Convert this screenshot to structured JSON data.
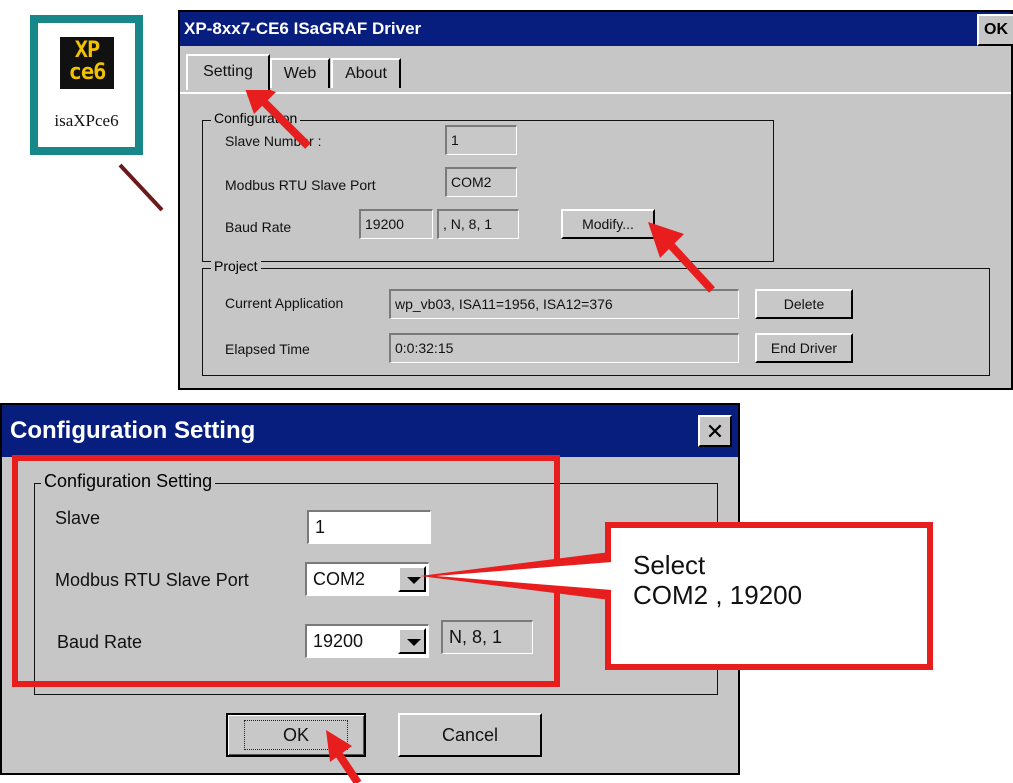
{
  "desktop_icon": {
    "image_text_line1": "XP",
    "image_text_line2": "ce6",
    "label": "isaXPce6",
    "icon": "isaXPce6-app-icon"
  },
  "driver_window": {
    "title": "XP-8xx7-CE6 ISaGRAF Driver",
    "ok_button": "OK",
    "tabs": [
      "Setting",
      "Web",
      "About"
    ],
    "configuration_group": {
      "legend": "Configuration",
      "slave_number_label": "Slave Number :",
      "slave_number_value": "1",
      "port_label": "Modbus RTU Slave Port",
      "port_value": "COM2",
      "baud_label": "Baud Rate",
      "baud_value": "19200",
      "baud_format": ", N, 8, 1",
      "modify_button": "Modify..."
    },
    "project_group": {
      "legend": "Project",
      "current_app_label": "Current Application",
      "current_app_value": "wp_vb03, ISA11=1956, ISA12=376",
      "delete_button": "Delete",
      "elapsed_label": "Elapsed Time",
      "elapsed_value": "0:0:32:15",
      "end_driver_button": "End Driver"
    }
  },
  "config_dialog": {
    "title": "Configuration Setting",
    "close_icon": "close-icon",
    "group_legend": "Configuration Setting",
    "slave_label": "Slave",
    "slave_value": "1",
    "port_label": "Modbus RTU Slave Port",
    "port_value": "COM2",
    "baud_label": "Baud Rate",
    "baud_value": "19200",
    "baud_format": "N, 8, 1",
    "ok_button": "OK",
    "cancel_button": "Cancel"
  },
  "callout": {
    "text": "Select\nCOM2 , 19200"
  },
  "colors": {
    "title_bar": "#081e7f",
    "window_face": "#c6c6c6",
    "highlight_red": "#e81e1e",
    "icon_frame": "#17878a",
    "connector_line": "#6b1a1a"
  }
}
